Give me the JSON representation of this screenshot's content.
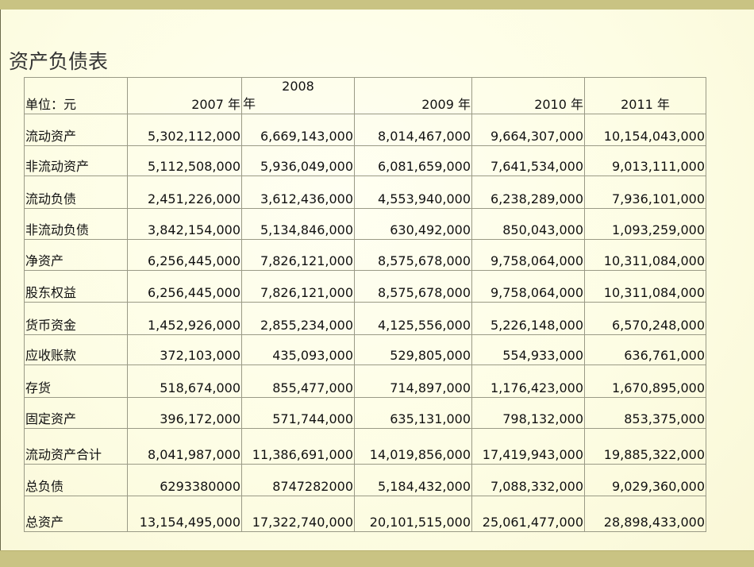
{
  "title": "资产负债表",
  "table": {
    "unit_label": "单位：元",
    "years": [
      "2007 年",
      "2008",
      "2009 年",
      "2010 年",
      "2011 年"
    ],
    "year_2008_suffix": "年",
    "rows": [
      {
        "label": "流动资产",
        "values": [
          "5,302,112,000",
          "6,669,143,000",
          "8,014,467,000",
          "9,664,307,000",
          "10,154,043,000"
        ]
      },
      {
        "label": "非流动资产",
        "values": [
          "5,112,508,000",
          "5,936,049,000",
          "6,081,659,000",
          "7,641,534,000",
          "9,013,111,000"
        ]
      },
      {
        "label": "流动负债",
        "values": [
          "2,451,226,000",
          "3,612,436,000",
          "4,553,940,000",
          "6,238,289,000",
          "7,936,101,000"
        ]
      },
      {
        "label": "非流动负债",
        "values": [
          "3,842,154,000",
          "5,134,846,000",
          "630,492,000",
          "850,043,000",
          "1,093,259,000"
        ]
      },
      {
        "label": "净资产",
        "values": [
          "6,256,445,000",
          "7,826,121,000",
          "8,575,678,000",
          "9,758,064,000",
          "10,311,084,000"
        ]
      },
      {
        "label": "股东权益",
        "values": [
          "6,256,445,000",
          "7,826,121,000",
          "8,575,678,000",
          "9,758,064,000",
          "10,311,084,000"
        ]
      },
      {
        "label": "货币资金",
        "values": [
          "1,452,926,000",
          "2,855,234,000",
          "4,125,556,000",
          "5,226,148,000",
          "6,570,248,000"
        ]
      },
      {
        "label": "应收账款",
        "values": [
          "372,103,000",
          "435,093,000",
          "529,805,000",
          "554,933,000",
          "636,761,000"
        ]
      },
      {
        "label": "存货",
        "values": [
          "518,674,000",
          "855,477,000",
          "714,897,000",
          "1,176,423,000",
          "1,670,895,000"
        ]
      },
      {
        "label": "固定资产",
        "values": [
          "396,172,000",
          "571,744,000",
          "635,131,000",
          "798,132,000",
          "853,375,000"
        ]
      },
      {
        "label": "流动资产合计",
        "values": [
          "8,041,987,000",
          "11,386,691,000",
          "14,019,856,000",
          "17,419,943,000",
          "19,885,322,000"
        ]
      },
      {
        "label": "总负债",
        "values": [
          "6293380000",
          "8747282000",
          "5,184,432,000",
          "7,088,332,000",
          "9,029,360,000"
        ]
      },
      {
        "label": "总资产",
        "values": [
          "13,154,495,000",
          "17,322,740,000",
          "20,101,515,000",
          "25,061,477,000",
          "28,898,433,000"
        ]
      }
    ]
  }
}
